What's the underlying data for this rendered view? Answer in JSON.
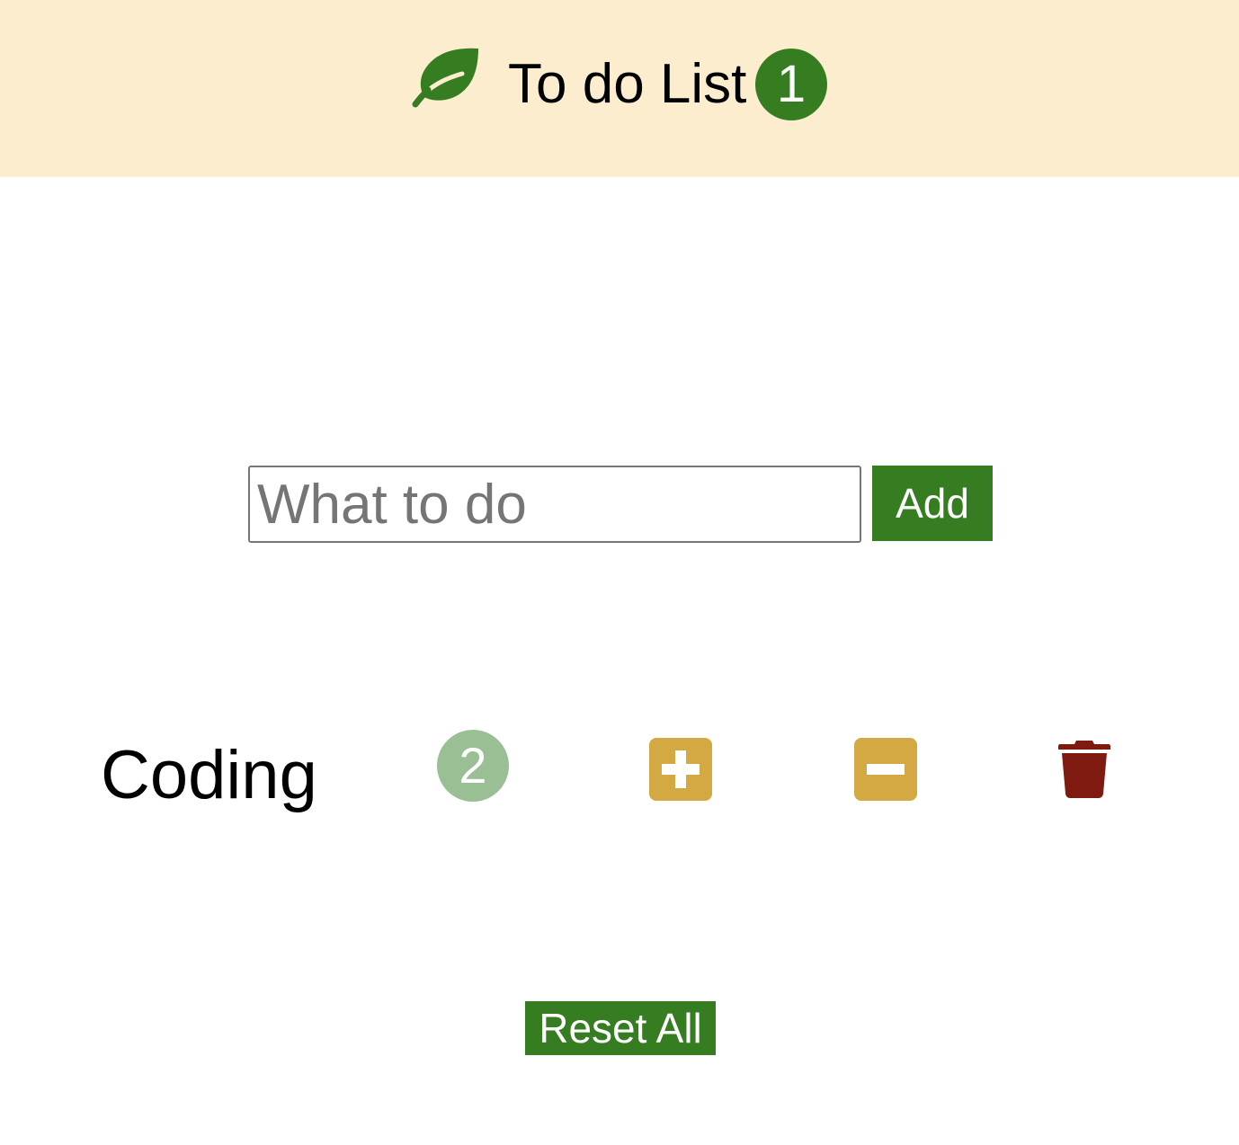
{
  "header": {
    "logo_icon": "leaf-icon",
    "title": "To do List",
    "item_count": "1",
    "background_color": "#fcedcf",
    "accent_color": "#367d22"
  },
  "form": {
    "input_placeholder": "What to do",
    "input_value": "",
    "add_label": "Add"
  },
  "items": [
    {
      "label": "Coding",
      "count": "2",
      "increment_icon": "plus-square-icon",
      "decrement_icon": "minus-square-icon",
      "delete_icon": "trash-icon"
    }
  ],
  "colors": {
    "item_count_badge": "#9bbf95",
    "increment_decrement": "#d4a843",
    "delete": "#7e1a0f"
  },
  "footer": {
    "reset_label": "Reset All"
  }
}
